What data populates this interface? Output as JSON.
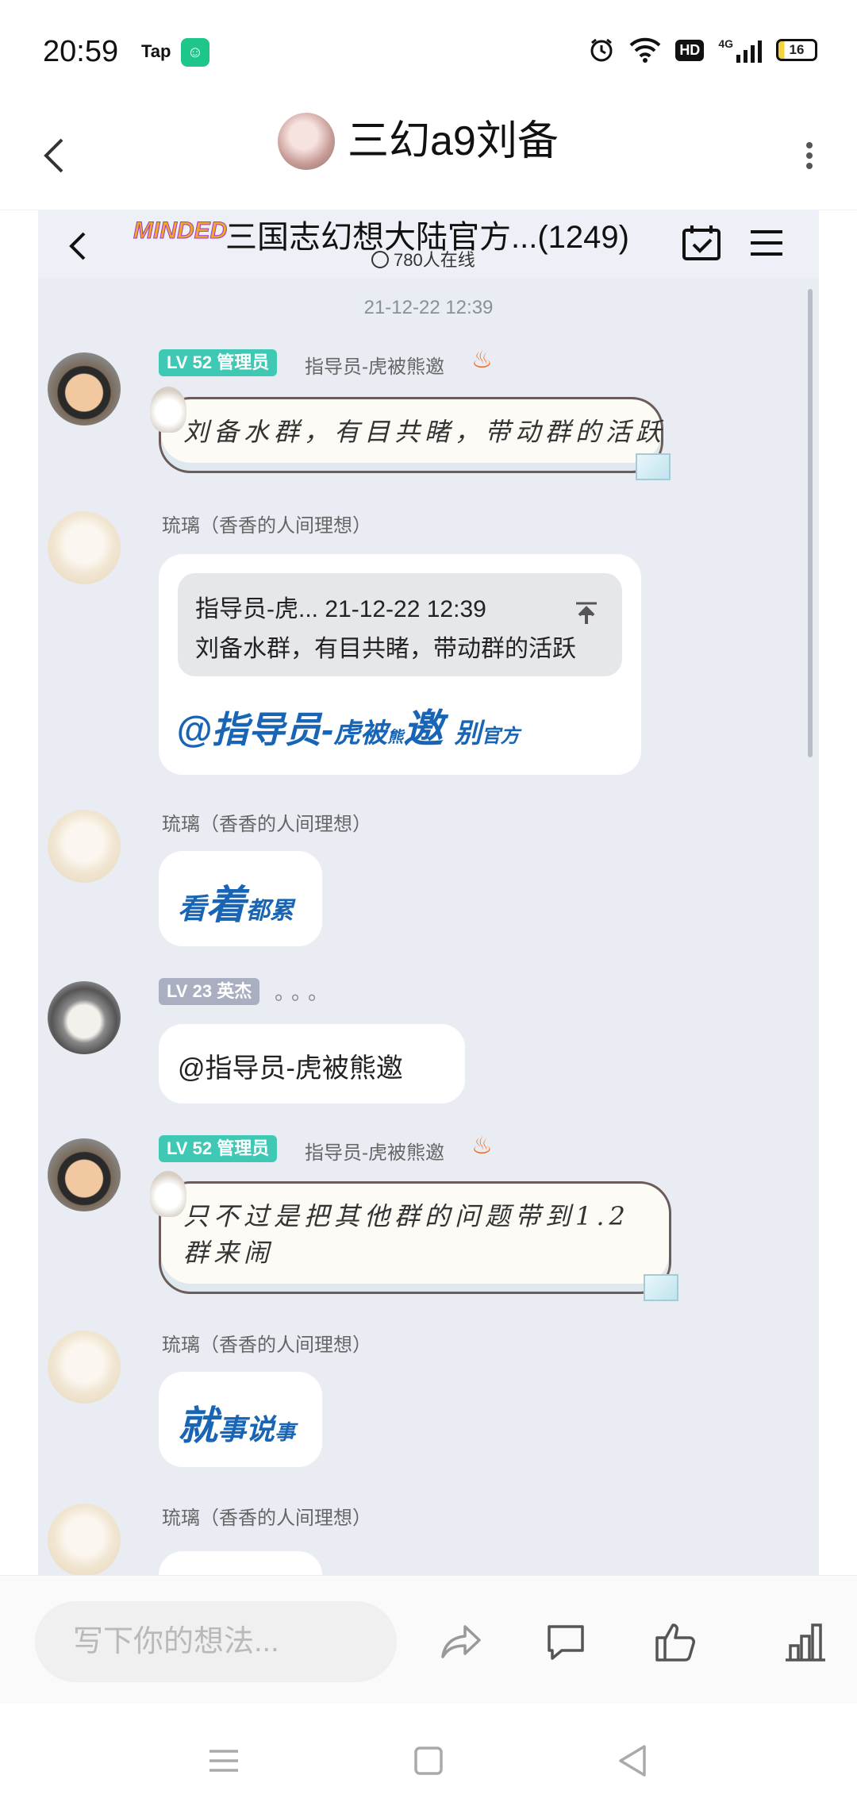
{
  "status_bar": {
    "time": "20:59",
    "tap_label": "Tap",
    "battery": "16",
    "network": "4G",
    "hd": "HD"
  },
  "header": {
    "title": "三幻a9刘备"
  },
  "screenshot": {
    "group_name": "三国志幻想大陆官方...(1249)",
    "brand": "MINDED",
    "online": "780人在线",
    "timestamp": "21-12-22 12:39",
    "messages": [
      {
        "badge_level": "LV 52",
        "badge_role": "管理员",
        "sender": "指导员-虎被熊邀",
        "text": "刘备水群，有目共睹，带动群的活跃"
      },
      {
        "sender": "琉璃（香香的人间理想）",
        "quote_header": "指导员-虎... 21-12-22 12:39",
        "quote_text": "刘备水群，有目共睹，带动群的活跃",
        "text_part1": "@指导员-",
        "text_part2": "虎被",
        "text_part3": "熊",
        "text_part4": "邀",
        "text_part5": "别",
        "text_part6": "官方"
      },
      {
        "sender": "琉璃（香香的人间理想）",
        "text_part1": "看",
        "text_part2": "着",
        "text_part3": "都累"
      },
      {
        "badge_level": "LV 23",
        "badge_role": "英杰",
        "dots": "。。。",
        "text": "@指导员-虎被熊邀"
      },
      {
        "badge_level": "LV 52",
        "badge_role": "管理员",
        "sender": "指导员-虎被熊邀",
        "text": "只不过是把其他群的问题带到1.2群来闹"
      },
      {
        "sender": "琉璃（香香的人间理想）",
        "text_part1": "就",
        "text_part2": "事说",
        "text_part3": "事"
      },
      {
        "sender": "琉璃（香香的人间理想）"
      }
    ]
  },
  "bottom_bar": {
    "input_placeholder": "写下你的想法..."
  },
  "icons": {
    "back": "back-arrow-icon",
    "more": "more-vertical-icon",
    "share": "share-icon",
    "comment": "comment-icon",
    "like": "thumbs-up-icon",
    "stats": "bar-chart-icon",
    "nav_menu": "nav-menu-icon",
    "nav_home": "nav-home-icon",
    "nav_back": "nav-back-icon"
  },
  "colors": {
    "accent_blue": "#1864b5",
    "badge_green": "#3fc9b5",
    "badge_grey": "#a9aec0",
    "screenshot_bg": "#e9ecf3"
  }
}
